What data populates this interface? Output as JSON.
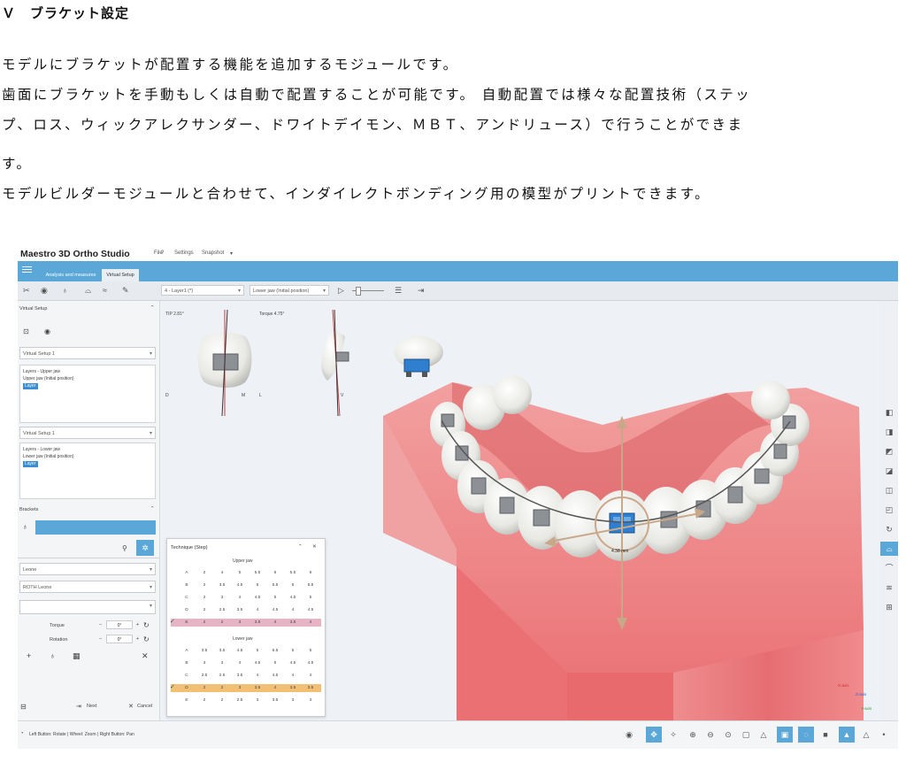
{
  "document": {
    "heading": "Ｖ　ブラケット設定",
    "paragraphs": [
      "モデルにブラケットが配置する機能を追加するモジュールです。",
      "歯面にブラケットを手動もしくは自動で配置することが可能です。 自動配置では様々な配置技術（ステッ",
      "プ、ロス、ウィックアレクサンダー、ドワイトデイモン、ＭＢＴ、アンドリュース）で行うことができま",
      "す。",
      "モデルビルダーモジュールと合わせて、インダイレクトボンディング用の模型がプリントできます。"
    ]
  },
  "app": {
    "title": "Maestro 3D Ortho Studio",
    "menu": [
      "File",
      "?",
      "Settings",
      "Snapshot"
    ],
    "tabs": [
      "Analysis and measures",
      "Virtual Setup"
    ],
    "toolbar": {
      "layer_select": "4 - Layer1 (*)",
      "jaw_select": "Lower jaw (Initial position)"
    },
    "left_panel": {
      "virtual_setup_title": "Virtual Setup",
      "setup_select_1": "Virtual Setup 1",
      "upper_layers_title": "Layers - Upper jaw",
      "upper_layers_item": "Upper jaw (Initial position)",
      "upper_chip": "Layer",
      "setup_select_2": "Virtual Setup 1",
      "lower_layers_title": "Layers - Lower jaw",
      "lower_layers_item": "Lower jaw (Initial position)",
      "lower_chip": "Layer",
      "brackets_title": "Brackets",
      "bracket_select_1": "Leone",
      "bracket_select_2": "ROTH Leone",
      "torque_label": "Torque",
      "torque_value": "0°",
      "rotation_label": "Rotation",
      "rotation_value": "0°",
      "next_button": "Next",
      "cancel_button": "Cancel"
    },
    "viewport": {
      "tip_label": "TIP 2.81°",
      "torque_label": "Torque 4.75°",
      "side_labels": [
        "D",
        "M",
        "L",
        "V"
      ],
      "measure_label": "4.38 mm",
      "axes": [
        "X-axis",
        "Z-axis",
        "Y-axis"
      ]
    },
    "technique_panel": {
      "title": "Technique (Step)",
      "upper_label": "Upper jaw",
      "lower_label": "Lower jaw",
      "upper_rows": [
        [
          "A",
          "2",
          "4",
          "5",
          "5.5",
          "6",
          "5.5",
          "6"
        ],
        [
          "B",
          "2",
          "3.5",
          "4.5",
          "5",
          "5.5",
          "5",
          "5.5"
        ],
        [
          "C",
          "2",
          "3",
          "4",
          "4.5",
          "5",
          "4.5",
          "5"
        ],
        [
          "D",
          "2",
          "2.5",
          "3.5",
          "4",
          "4.5",
          "4",
          "4.5"
        ],
        [
          "E",
          "2",
          "2",
          "3",
          "3.5",
          "4",
          "3.5",
          "4"
        ]
      ],
      "lower_rows": [
        [
          "A",
          "3.5",
          "3.5",
          "4.5",
          "5",
          "5.5",
          "5",
          "5"
        ],
        [
          "B",
          "3",
          "3",
          "4",
          "4.5",
          "5",
          "4.5",
          "4.5"
        ],
        [
          "C",
          "2.5",
          "2.5",
          "3.5",
          "4",
          "4.5",
          "4",
          "4"
        ],
        [
          "D",
          "2",
          "2",
          "3",
          "3.5",
          "4",
          "3.5",
          "3.5"
        ],
        [
          "E",
          "2",
          "2",
          "2.5",
          "3",
          "3.5",
          "3",
          "3"
        ]
      ]
    },
    "status_hint": "Left Button: Rotate | Wheel: Zoom | Right Button: Pan",
    "colors": {
      "accent": "#5aa7d8",
      "gum": "#ea6f72",
      "pink_row": "#e6b4c4",
      "orange_row": "#f2c074"
    }
  }
}
